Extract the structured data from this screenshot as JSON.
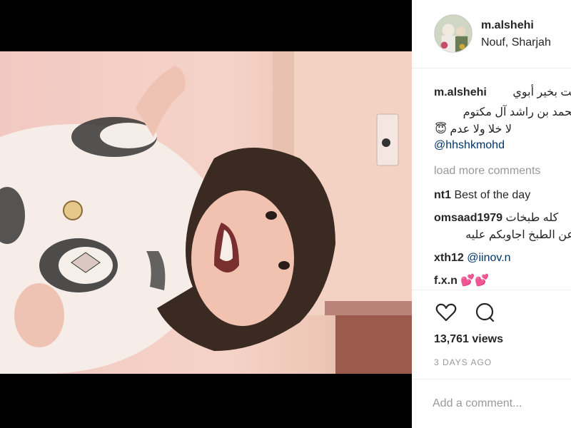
{
  "post": {
    "username": "m.alshehi",
    "location": "Nouf, Sharjah"
  },
  "caption": {
    "username": "m.alshehi",
    "line1": "أنت بخير أبوي",
    "line2": "محمد بن راشد آل مكتوم",
    "line3": "لا خلا ولا عدم 😇",
    "mention": "@hhshkmohd"
  },
  "load_more": "load more comments",
  "comments": [
    {
      "user": "nt1",
      "text": "Best of the day"
    },
    {
      "user": "omsaad1979",
      "text": "كله طبخات"
    },
    {
      "user": "",
      "text": "ل عن الطبخ اجاوبكم عليه"
    },
    {
      "user": "xth12",
      "text": "@iinov.n"
    },
    {
      "user": "f.x.n",
      "text": "💕💕"
    }
  ],
  "stats": {
    "views": "13,761 views",
    "time": "3 DAYS AGO"
  },
  "composer": {
    "placeholder": "Add a comment..."
  },
  "icons": {
    "like": "heart-icon",
    "comment": "comment-icon"
  }
}
